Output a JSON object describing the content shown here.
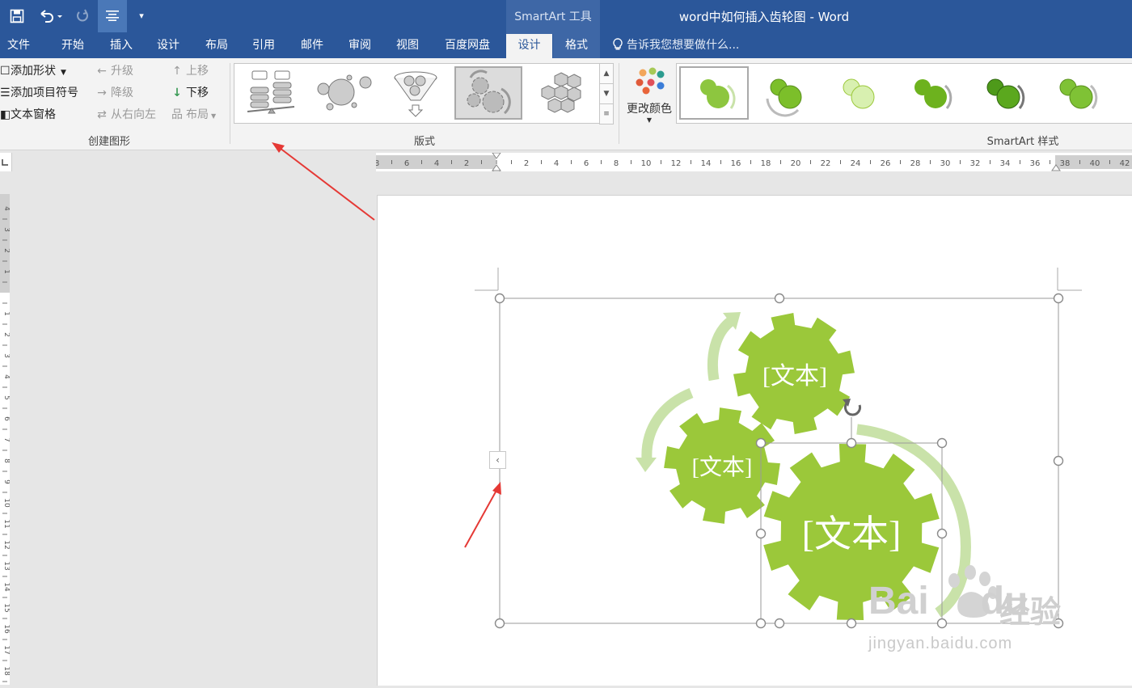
{
  "window": {
    "title": "word中如何插入齿轮图 - Word",
    "contextual_tab_group": "SmartArt 工具"
  },
  "tabs": [
    {
      "label": "文件"
    },
    {
      "label": "开始"
    },
    {
      "label": "插入"
    },
    {
      "label": "设计"
    },
    {
      "label": "布局"
    },
    {
      "label": "引用"
    },
    {
      "label": "邮件"
    },
    {
      "label": "审阅"
    },
    {
      "label": "视图"
    },
    {
      "label": "百度网盘"
    },
    {
      "label": "设计"
    },
    {
      "label": "格式"
    }
  ],
  "tell_me": "告诉我您想要做什么...",
  "ribbon": {
    "create_graphic": {
      "label": "创建图形",
      "add_shape": "添加形状",
      "add_bullet": "添加项目符号",
      "text_pane": "文本窗格",
      "promote": "升级",
      "demote": "降级",
      "right_to_left": "从右向左",
      "move_up": "上移",
      "move_down": "下移",
      "layout": "布局"
    },
    "layouts": {
      "label": "版式"
    },
    "change_colors": "更改颜色",
    "smartart_styles": {
      "label": "SmartArt 样式"
    }
  },
  "diagram": {
    "nodes": [
      {
        "text": "[文本]"
      },
      {
        "text": "[文本]"
      },
      {
        "text": "[文本]"
      }
    ],
    "gear_color": "#9bc83a",
    "arrow_color": "#c9e2a9"
  },
  "watermark": {
    "brand": "Bai",
    "brand_suffix": "du",
    "cn": "经验",
    "url": "jingyan.baidu.com"
  },
  "colors": {
    "title_bar": "#2b579a",
    "contextual": "#3e67a6",
    "ribbon_bg": "#f3f3f3",
    "annotation_arrow": "#e53935"
  }
}
